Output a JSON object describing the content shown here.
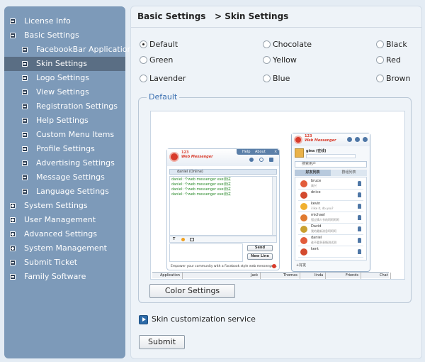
{
  "sidebar": {
    "items": [
      {
        "label": "License Info",
        "level": "top",
        "toggle": "minus",
        "active": false
      },
      {
        "label": "Basic Settings",
        "level": "top",
        "toggle": "minus",
        "active": false
      },
      {
        "label": "FacebookBar Application",
        "level": "sub",
        "toggle": "minus",
        "active": false
      },
      {
        "label": "Skin Settings",
        "level": "sub",
        "toggle": "minus",
        "active": true
      },
      {
        "label": "Logo Settings",
        "level": "sub",
        "toggle": "minus",
        "active": false
      },
      {
        "label": "View Settings",
        "level": "sub",
        "toggle": "minus",
        "active": false
      },
      {
        "label": "Registration Settings",
        "level": "sub",
        "toggle": "minus",
        "active": false
      },
      {
        "label": "Help Settings",
        "level": "sub",
        "toggle": "minus",
        "active": false
      },
      {
        "label": "Custom Menu Items",
        "level": "sub",
        "toggle": "minus",
        "active": false
      },
      {
        "label": "Profile Settings",
        "level": "sub",
        "toggle": "minus",
        "active": false
      },
      {
        "label": "Advertising Settings",
        "level": "sub",
        "toggle": "minus",
        "active": false
      },
      {
        "label": "Message Settings",
        "level": "sub",
        "toggle": "minus",
        "active": false
      },
      {
        "label": "Language Settings",
        "level": "sub",
        "toggle": "minus",
        "active": false
      },
      {
        "label": "System Settings",
        "level": "top",
        "toggle": "plus",
        "active": false
      },
      {
        "label": "User Management",
        "level": "top",
        "toggle": "plus",
        "active": false
      },
      {
        "label": "Advanced Settings",
        "level": "top",
        "toggle": "plus",
        "active": false
      },
      {
        "label": "System Management",
        "level": "top",
        "toggle": "plus",
        "active": false
      },
      {
        "label": "Submit Ticket",
        "level": "top",
        "toggle": "minus",
        "active": false
      },
      {
        "label": "Family Software",
        "level": "top",
        "toggle": "minus",
        "active": false
      }
    ]
  },
  "header": {
    "breadcrumb": "Basic Settings   > Skin Settings"
  },
  "skins": [
    {
      "label": "Default",
      "selected": true
    },
    {
      "label": "Chocolate",
      "selected": false
    },
    {
      "label": "Black",
      "selected": false
    },
    {
      "label": "Green",
      "selected": false
    },
    {
      "label": "Yellow",
      "selected": false
    },
    {
      "label": "Red",
      "selected": false
    },
    {
      "label": "Lavender",
      "selected": false
    },
    {
      "label": "Blue",
      "selected": false
    },
    {
      "label": "Brown",
      "selected": false
    }
  ],
  "preview": {
    "legend": "Default",
    "chat": {
      "logo_top": "123",
      "logo_bottom": "Web Messenger",
      "help": "Help",
      "about": "About",
      "contact": "daniel (Online)",
      "lines": [
        "daniel: 个web messenger exe测试",
        "daniel: 个web messenger exe测试",
        "daniel: 个web messenger exe测试",
        "daniel: 个web messenger exe测试"
      ],
      "send": "Send",
      "new_line": "New Line",
      "footer": "Empower your community with a Facebook style web messenger..."
    },
    "buddy": {
      "logo_top": "123",
      "logo_bottom": "Web Messenger",
      "user": "gina (在线)",
      "search": "搜索用户",
      "tab_friends": "好友列表",
      "tab_groups": "群组列表",
      "contacts": [
        {
          "name": "bruce",
          "status": "高兴"
        },
        {
          "name": "dnico",
          "status": ""
        },
        {
          "name": "kevin",
          "status": "i like it, do you?"
        },
        {
          "name": "michael",
          "status": "错过情人节的呵呵呵呵"
        },
        {
          "name": "David",
          "status": "我的最新消息呵呵呵"
        },
        {
          "name": "daniel",
          "status": "谁不要多表情测试测"
        },
        {
          "name": "kent",
          "status": ""
        }
      ],
      "add": "+好友"
    },
    "taskbar": [
      "Application",
      "Jack",
      "Thomas",
      "linda",
      "Friends",
      "Chat"
    ]
  },
  "actions": {
    "color_settings": "Color Settings",
    "service_link": "Skin customization service",
    "submit": "Submit"
  }
}
